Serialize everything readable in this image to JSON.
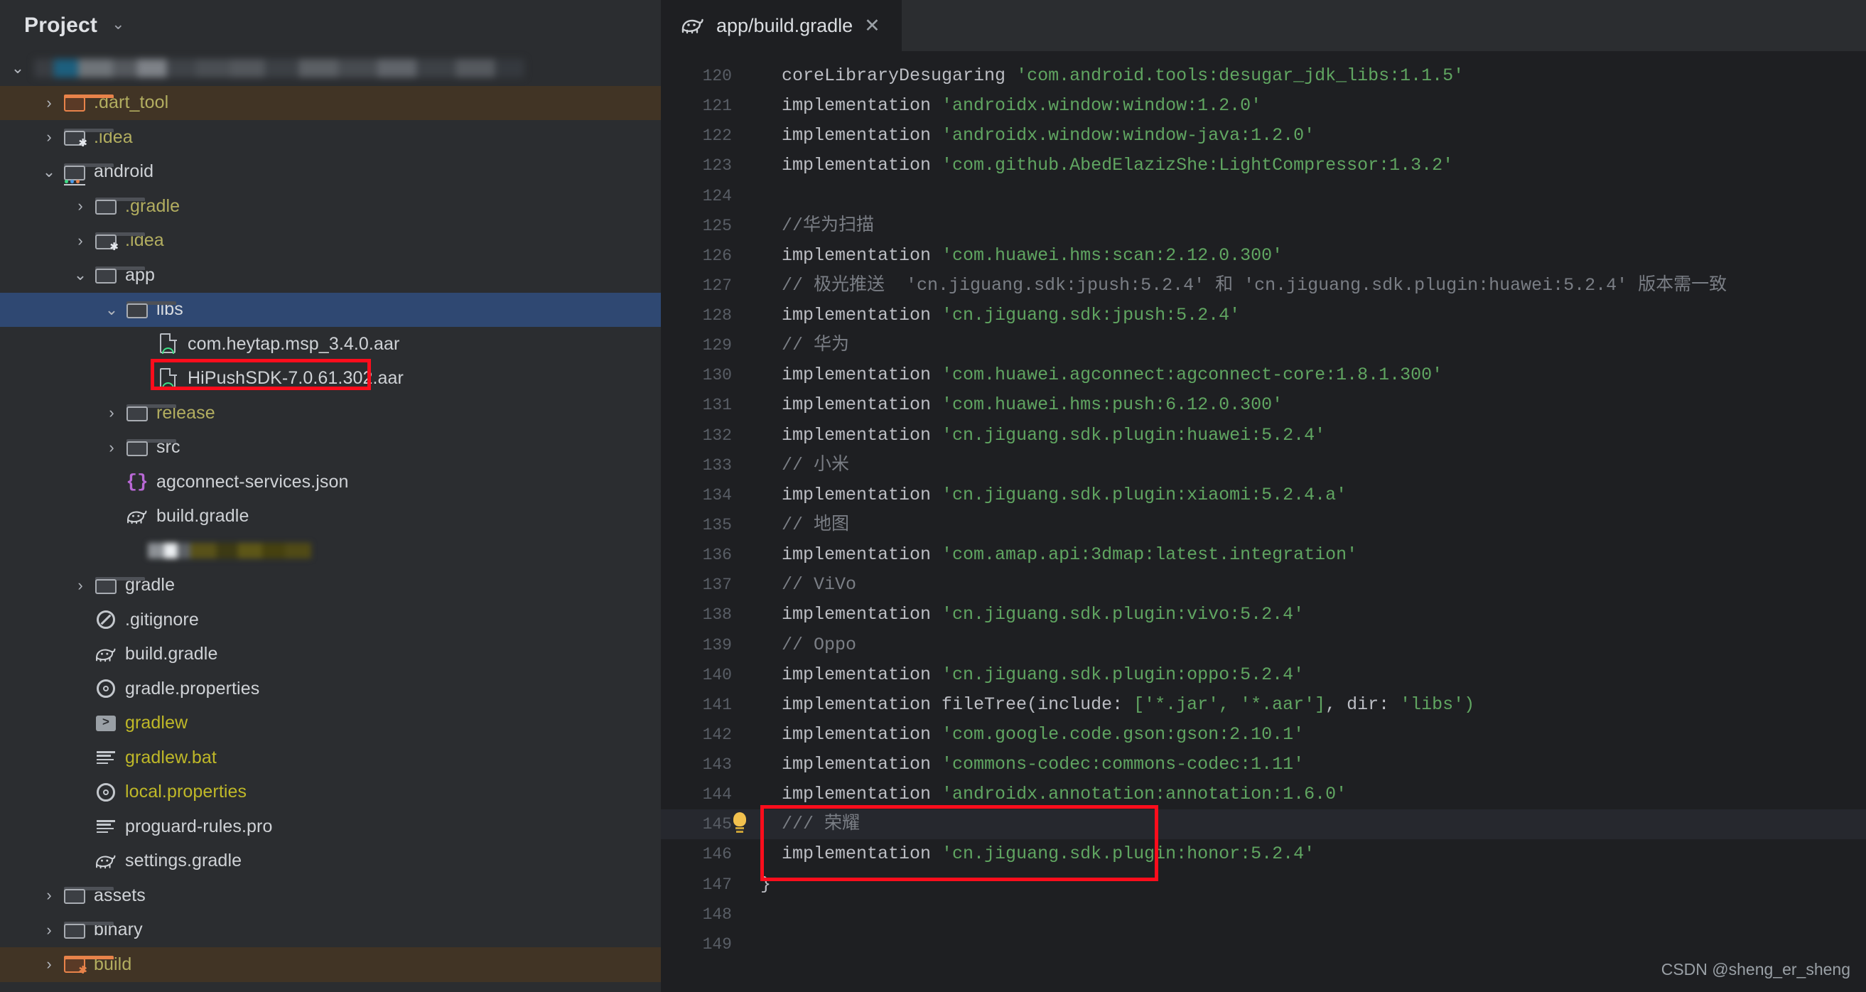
{
  "sidebar": {
    "title": "Project",
    "chevron_icon": "chevron-down-icon",
    "tree": [
      {
        "indent": 0,
        "twisty": "v",
        "icon": "redacted",
        "label": "",
        "redacted": true,
        "kind": "blur"
      },
      {
        "indent": 1,
        "twisty": ">",
        "icon": "folder-orange-icon",
        "label": ".dart_tool",
        "color": "yellow",
        "row": "brown"
      },
      {
        "indent": 1,
        "twisty": ">",
        "icon": "folder-star-icon",
        "label": ".idea",
        "color": "yellow"
      },
      {
        "indent": 1,
        "twisty": "v",
        "icon": "folder-android-icon",
        "label": "android",
        "color": "white"
      },
      {
        "indent": 2,
        "twisty": ">",
        "icon": "folder-icon",
        "label": ".gradle",
        "color": "yellow"
      },
      {
        "indent": 2,
        "twisty": ">",
        "icon": "folder-star-icon",
        "label": ".idea",
        "color": "yellow"
      },
      {
        "indent": 2,
        "twisty": "v",
        "icon": "folder-icon",
        "label": "app",
        "color": "white"
      },
      {
        "indent": 3,
        "twisty": "v",
        "icon": "folder-icon",
        "label": "libs",
        "color": "white",
        "row": "selected"
      },
      {
        "indent": 4,
        "twisty": "",
        "icon": "aar-file-icon",
        "label": "com.heytap.msp_3.4.0.aar",
        "color": "white"
      },
      {
        "indent": 4,
        "twisty": "",
        "icon": "aar-file-icon",
        "label": "HiPushSDK-7.0.61.302.aar",
        "color": "white",
        "boxed": true
      },
      {
        "indent": 3,
        "twisty": ">",
        "icon": "folder-icon",
        "label": "release",
        "color": "yellow"
      },
      {
        "indent": 3,
        "twisty": ">",
        "icon": "folder-icon",
        "label": "src",
        "color": "white"
      },
      {
        "indent": 3,
        "twisty": "",
        "icon": "json-file-icon",
        "label": "agconnect-services.json",
        "color": "white"
      },
      {
        "indent": 3,
        "twisty": "",
        "icon": "gradle-file-icon",
        "label": "build.gradle",
        "color": "white"
      },
      {
        "indent": 3,
        "twisty": "",
        "icon": "redacted",
        "label": "",
        "redacted": true,
        "kind": "blur2"
      },
      {
        "indent": 2,
        "twisty": ">",
        "icon": "folder-icon",
        "label": "gradle",
        "color": "white"
      },
      {
        "indent": 2,
        "twisty": "",
        "icon": "gitignore-icon",
        "label": ".gitignore",
        "color": "white"
      },
      {
        "indent": 2,
        "twisty": "",
        "icon": "gradle-file-icon",
        "label": "build.gradle",
        "color": "white"
      },
      {
        "indent": 2,
        "twisty": "",
        "icon": "properties-icon",
        "label": "gradle.properties",
        "color": "white"
      },
      {
        "indent": 2,
        "twisty": "",
        "icon": "shell-script-icon",
        "label": "gradlew",
        "color": "yellowBright"
      },
      {
        "indent": 2,
        "twisty": "",
        "icon": "text-file-icon",
        "label": "gradlew.bat",
        "color": "yellowBright"
      },
      {
        "indent": 2,
        "twisty": "",
        "icon": "properties-icon",
        "label": "local.properties",
        "color": "yellowBright"
      },
      {
        "indent": 2,
        "twisty": "",
        "icon": "text-file-icon",
        "label": "proguard-rules.pro",
        "color": "white"
      },
      {
        "indent": 2,
        "twisty": "",
        "icon": "gradle-file-icon",
        "label": "settings.gradle",
        "color": "white"
      },
      {
        "indent": 1,
        "twisty": ">",
        "icon": "folder-icon",
        "label": "assets",
        "color": "white"
      },
      {
        "indent": 1,
        "twisty": ">",
        "icon": "folder-icon",
        "label": "binary",
        "color": "white"
      },
      {
        "indent": 1,
        "twisty": ">",
        "icon": "folder-orange-star-icon",
        "label": "build",
        "color": "yellow",
        "row": "brown"
      }
    ]
  },
  "editor": {
    "tab": {
      "icon": "gradle-file-icon",
      "name": "app/build.gradle",
      "close_icon": "close-icon"
    },
    "first_line_number": 120,
    "current_line": 145,
    "lines": [
      {
        "n": 120,
        "segments": [
          {
            "t": "  coreLibraryDesugaring ",
            "c": "kw"
          },
          {
            "t": "'com.android.tools:desugar_jdk_libs:1.1.5'",
            "c": "str"
          }
        ]
      },
      {
        "n": 121,
        "segments": [
          {
            "t": "  implementation ",
            "c": "kw"
          },
          {
            "t": "'androidx.window:window:1.2.0'",
            "c": "str"
          }
        ]
      },
      {
        "n": 122,
        "segments": [
          {
            "t": "  implementation ",
            "c": "kw"
          },
          {
            "t": "'androidx.window:window-java:1.2.0'",
            "c": "str"
          }
        ]
      },
      {
        "n": 123,
        "segments": [
          {
            "t": "  implementation ",
            "c": "kw"
          },
          {
            "t": "'com.github.AbedElazizShe:LightCompressor:1.3.2'",
            "c": "str"
          }
        ]
      },
      {
        "n": 124,
        "segments": []
      },
      {
        "n": 125,
        "segments": [
          {
            "t": "  //华为扫描",
            "c": "cmt"
          }
        ]
      },
      {
        "n": 126,
        "segments": [
          {
            "t": "  implementation ",
            "c": "kw"
          },
          {
            "t": "'com.huawei.hms:scan:2.12.0.300'",
            "c": "str"
          }
        ]
      },
      {
        "n": 127,
        "segments": [
          {
            "t": "  // 极光推送  'cn.jiguang.sdk:jpush:5.2.4' 和 'cn.jiguang.sdk.plugin:huawei:5.2.4' 版本需一致",
            "c": "cmt"
          }
        ]
      },
      {
        "n": 128,
        "segments": [
          {
            "t": "  implementation ",
            "c": "kw"
          },
          {
            "t": "'cn.jiguang.sdk:jpush:5.2.4'",
            "c": "str"
          }
        ]
      },
      {
        "n": 129,
        "segments": [
          {
            "t": "  // 华为",
            "c": "cmt"
          }
        ]
      },
      {
        "n": 130,
        "segments": [
          {
            "t": "  implementation ",
            "c": "kw"
          },
          {
            "t": "'com.huawei.agconnect:agconnect-core:1.8.1.300'",
            "c": "str"
          }
        ]
      },
      {
        "n": 131,
        "segments": [
          {
            "t": "  implementation ",
            "c": "kw"
          },
          {
            "t": "'com.huawei.hms:push:6.12.0.300'",
            "c": "str"
          }
        ]
      },
      {
        "n": 132,
        "segments": [
          {
            "t": "  implementation ",
            "c": "kw"
          },
          {
            "t": "'cn.jiguang.sdk.plugin:huawei:5.2.4'",
            "c": "str"
          }
        ]
      },
      {
        "n": 133,
        "segments": [
          {
            "t": "  // 小米",
            "c": "cmt"
          }
        ]
      },
      {
        "n": 134,
        "segments": [
          {
            "t": "  implementation ",
            "c": "kw"
          },
          {
            "t": "'cn.jiguang.sdk.plugin:xiaomi:5.2.4.a'",
            "c": "str"
          }
        ]
      },
      {
        "n": 135,
        "segments": [
          {
            "t": "  // 地图",
            "c": "cmt"
          }
        ]
      },
      {
        "n": 136,
        "segments": [
          {
            "t": "  implementation ",
            "c": "kw"
          },
          {
            "t": "'com.amap.api:3dmap:latest.integration'",
            "c": "str"
          }
        ]
      },
      {
        "n": 137,
        "segments": [
          {
            "t": "  // ViVo",
            "c": "cmt"
          }
        ]
      },
      {
        "n": 138,
        "segments": [
          {
            "t": "  implementation ",
            "c": "kw"
          },
          {
            "t": "'cn.jiguang.sdk.plugin:vivo:5.2.4'",
            "c": "str"
          }
        ]
      },
      {
        "n": 139,
        "segments": [
          {
            "t": "  // Oppo",
            "c": "cmt"
          }
        ]
      },
      {
        "n": 140,
        "segments": [
          {
            "t": "  implementation ",
            "c": "kw"
          },
          {
            "t": "'cn.jiguang.sdk.plugin:oppo:5.2.4'",
            "c": "str"
          }
        ]
      },
      {
        "n": 141,
        "segments": [
          {
            "t": "  implementation fileTree(include: ",
            "c": "kw"
          },
          {
            "t": "['*.jar', '*.aar']",
            "c": "str"
          },
          {
            "t": ", dir: ",
            "c": "kw"
          },
          {
            "t": "'libs')",
            "c": "str"
          }
        ]
      },
      {
        "n": 142,
        "segments": [
          {
            "t": "  implementation ",
            "c": "kw"
          },
          {
            "t": "'com.google.code.gson:gson:2.10.1'",
            "c": "str"
          }
        ]
      },
      {
        "n": 143,
        "segments": [
          {
            "t": "  implementation ",
            "c": "kw"
          },
          {
            "t": "'commons-codec:commons-codec:1.11'",
            "c": "str"
          }
        ]
      },
      {
        "n": 144,
        "segments": [
          {
            "t": "  implementation ",
            "c": "kw"
          },
          {
            "t": "'androidx.annotation:annotation:1.6.0'",
            "c": "str"
          }
        ]
      },
      {
        "n": 145,
        "segments": [
          {
            "t": "  /// 荣耀",
            "c": "cmt"
          }
        ],
        "current": true,
        "bulb": true
      },
      {
        "n": 146,
        "segments": [
          {
            "t": "  implementation ",
            "c": "kw"
          },
          {
            "t": "'cn.jiguang.sdk.plugin:honor:5.2.4'",
            "c": "str"
          }
        ]
      },
      {
        "n": 147,
        "segments": [
          {
            "t": "}",
            "c": "plain"
          }
        ]
      },
      {
        "n": 148,
        "segments": []
      },
      {
        "n": 149,
        "segments": []
      }
    ],
    "annotation_color": "#fc0d1c",
    "watermark": "CSDN @sheng_er_sheng"
  }
}
